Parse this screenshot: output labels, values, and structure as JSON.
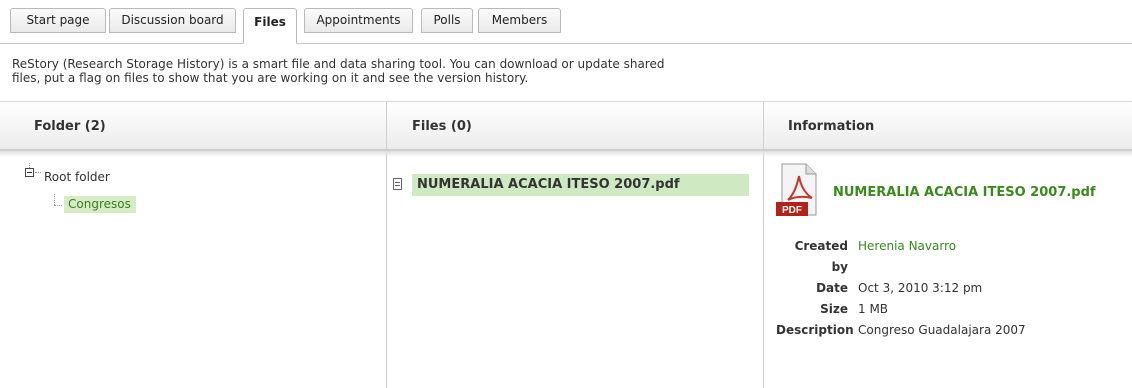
{
  "tabs": [
    {
      "label": "Start page",
      "active": false
    },
    {
      "label": "Discussion board",
      "active": false
    },
    {
      "label": "Files",
      "active": true
    },
    {
      "label": "Appointments",
      "active": false
    },
    {
      "label": "Polls",
      "active": false
    },
    {
      "label": "Members",
      "active": false
    }
  ],
  "intro": {
    "line1": "ReStory (Research Storage History) is a smart file and data sharing tool. You can download or update shared",
    "line2": "files, put a flag on files to show that you are working on it and see the version history."
  },
  "columns": {
    "folders": "Folder (2)",
    "files": "Files (0)",
    "information": "Information"
  },
  "tree": {
    "root": "Root folder",
    "children": [
      "Congresos"
    ]
  },
  "files": [
    {
      "name": "NUMERALIA ACACIA ITESO 2007.pdf",
      "selected": true
    }
  ],
  "info": {
    "icon": "pdf-file-icon",
    "pdf_badge": "PDF",
    "title": "NUMERALIA ACACIA ITESO 2007.pdf",
    "fields": [
      {
        "key": "Created by",
        "value": "Herenia Navarro",
        "link": true
      },
      {
        "key": "Date",
        "value": "Oct 3, 2010 3:12 pm",
        "link": false
      },
      {
        "key": "Size",
        "value": "1 MB",
        "link": false
      },
      {
        "key": "Description",
        "value": "Congreso Guadalajara 2007",
        "link": false
      }
    ]
  },
  "colors": {
    "accent": "#3a8a1c",
    "selected_bg": "#cfe9c2",
    "pdf_red": "#b2221a"
  }
}
